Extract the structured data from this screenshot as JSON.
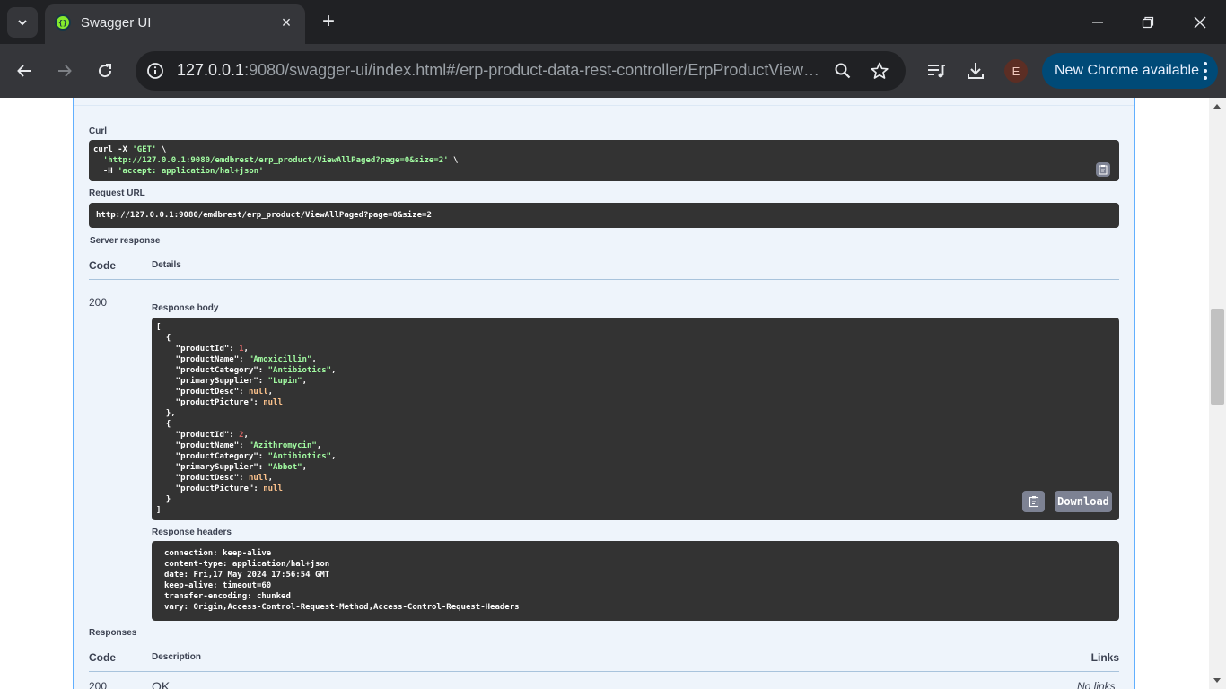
{
  "browser": {
    "tab_title": "Swagger UI",
    "favicon_glyph": "{}",
    "url_host": "127.0.0.1",
    "url_rest": ":9080/swagger-ui/index.html#/erp-product-data-rest-controller/ErpProductViewAll...",
    "profile_initial": "E",
    "update_label": "New Chrome available",
    "icons": [
      "tab-search-icon",
      "close-icon",
      "plus-icon",
      "minimize-icon",
      "restore-icon",
      "window-close-icon",
      "back-icon",
      "forward-icon",
      "reload-icon",
      "site-info-icon",
      "zoom-icon",
      "star-icon",
      "media-icon",
      "download-icon",
      "more-icon"
    ]
  },
  "swagger": {
    "curl_label": "Curl",
    "curl_line1_a": "curl -X ",
    "curl_line1_method": "'GET'",
    "curl_line1_b": " \\",
    "curl_line2_url": "'http://127.0.0.1:9080/emdbrest/erp_product/ViewAllPaged?page=0&size=2'",
    "curl_line2_b": " \\",
    "curl_line3_a": "  -H ",
    "curl_line3_header": "'accept: application/hal+json'",
    "request_url_label": "Request URL",
    "request_url": "http://127.0.0.1:9080/emdbrest/erp_product/ViewAllPaged?page=0&size=2",
    "server_response_label": "Server response",
    "code_header": "Code",
    "details_header": "Details",
    "response_code": "200",
    "response_body_label": "Response body",
    "response_body": [
      {
        "productId": "1",
        "productName": "\"Amoxicillin\"",
        "productCategory": "\"Antibiotics\"",
        "primarySupplier": "\"Lupin\"",
        "productDesc": "null",
        "productPicture": "null"
      },
      {
        "productId": "2",
        "productName": "\"Azithromycin\"",
        "productCategory": "\"Antibiotics\"",
        "primarySupplier": "\"Abbot\"",
        "productDesc": "null",
        "productPicture": "null"
      }
    ],
    "download_label": "Download",
    "response_headers_label": "Response headers",
    "response_headers": [
      "connection: keep-alive",
      "content-type: application/hal+json",
      "date: Fri,17 May 2024 17:56:54 GMT",
      "keep-alive: timeout=60",
      "transfer-encoding: chunked",
      "vary: Origin,Access-Control-Request-Method,Access-Control-Request-Headers"
    ],
    "responses_label": "Responses",
    "responses_code_header": "Code",
    "responses_desc_header": "Description",
    "responses_links_header": "Links",
    "responses_row_code": "200",
    "responses_row_desc": "OK",
    "responses_row_links": "No links"
  }
}
